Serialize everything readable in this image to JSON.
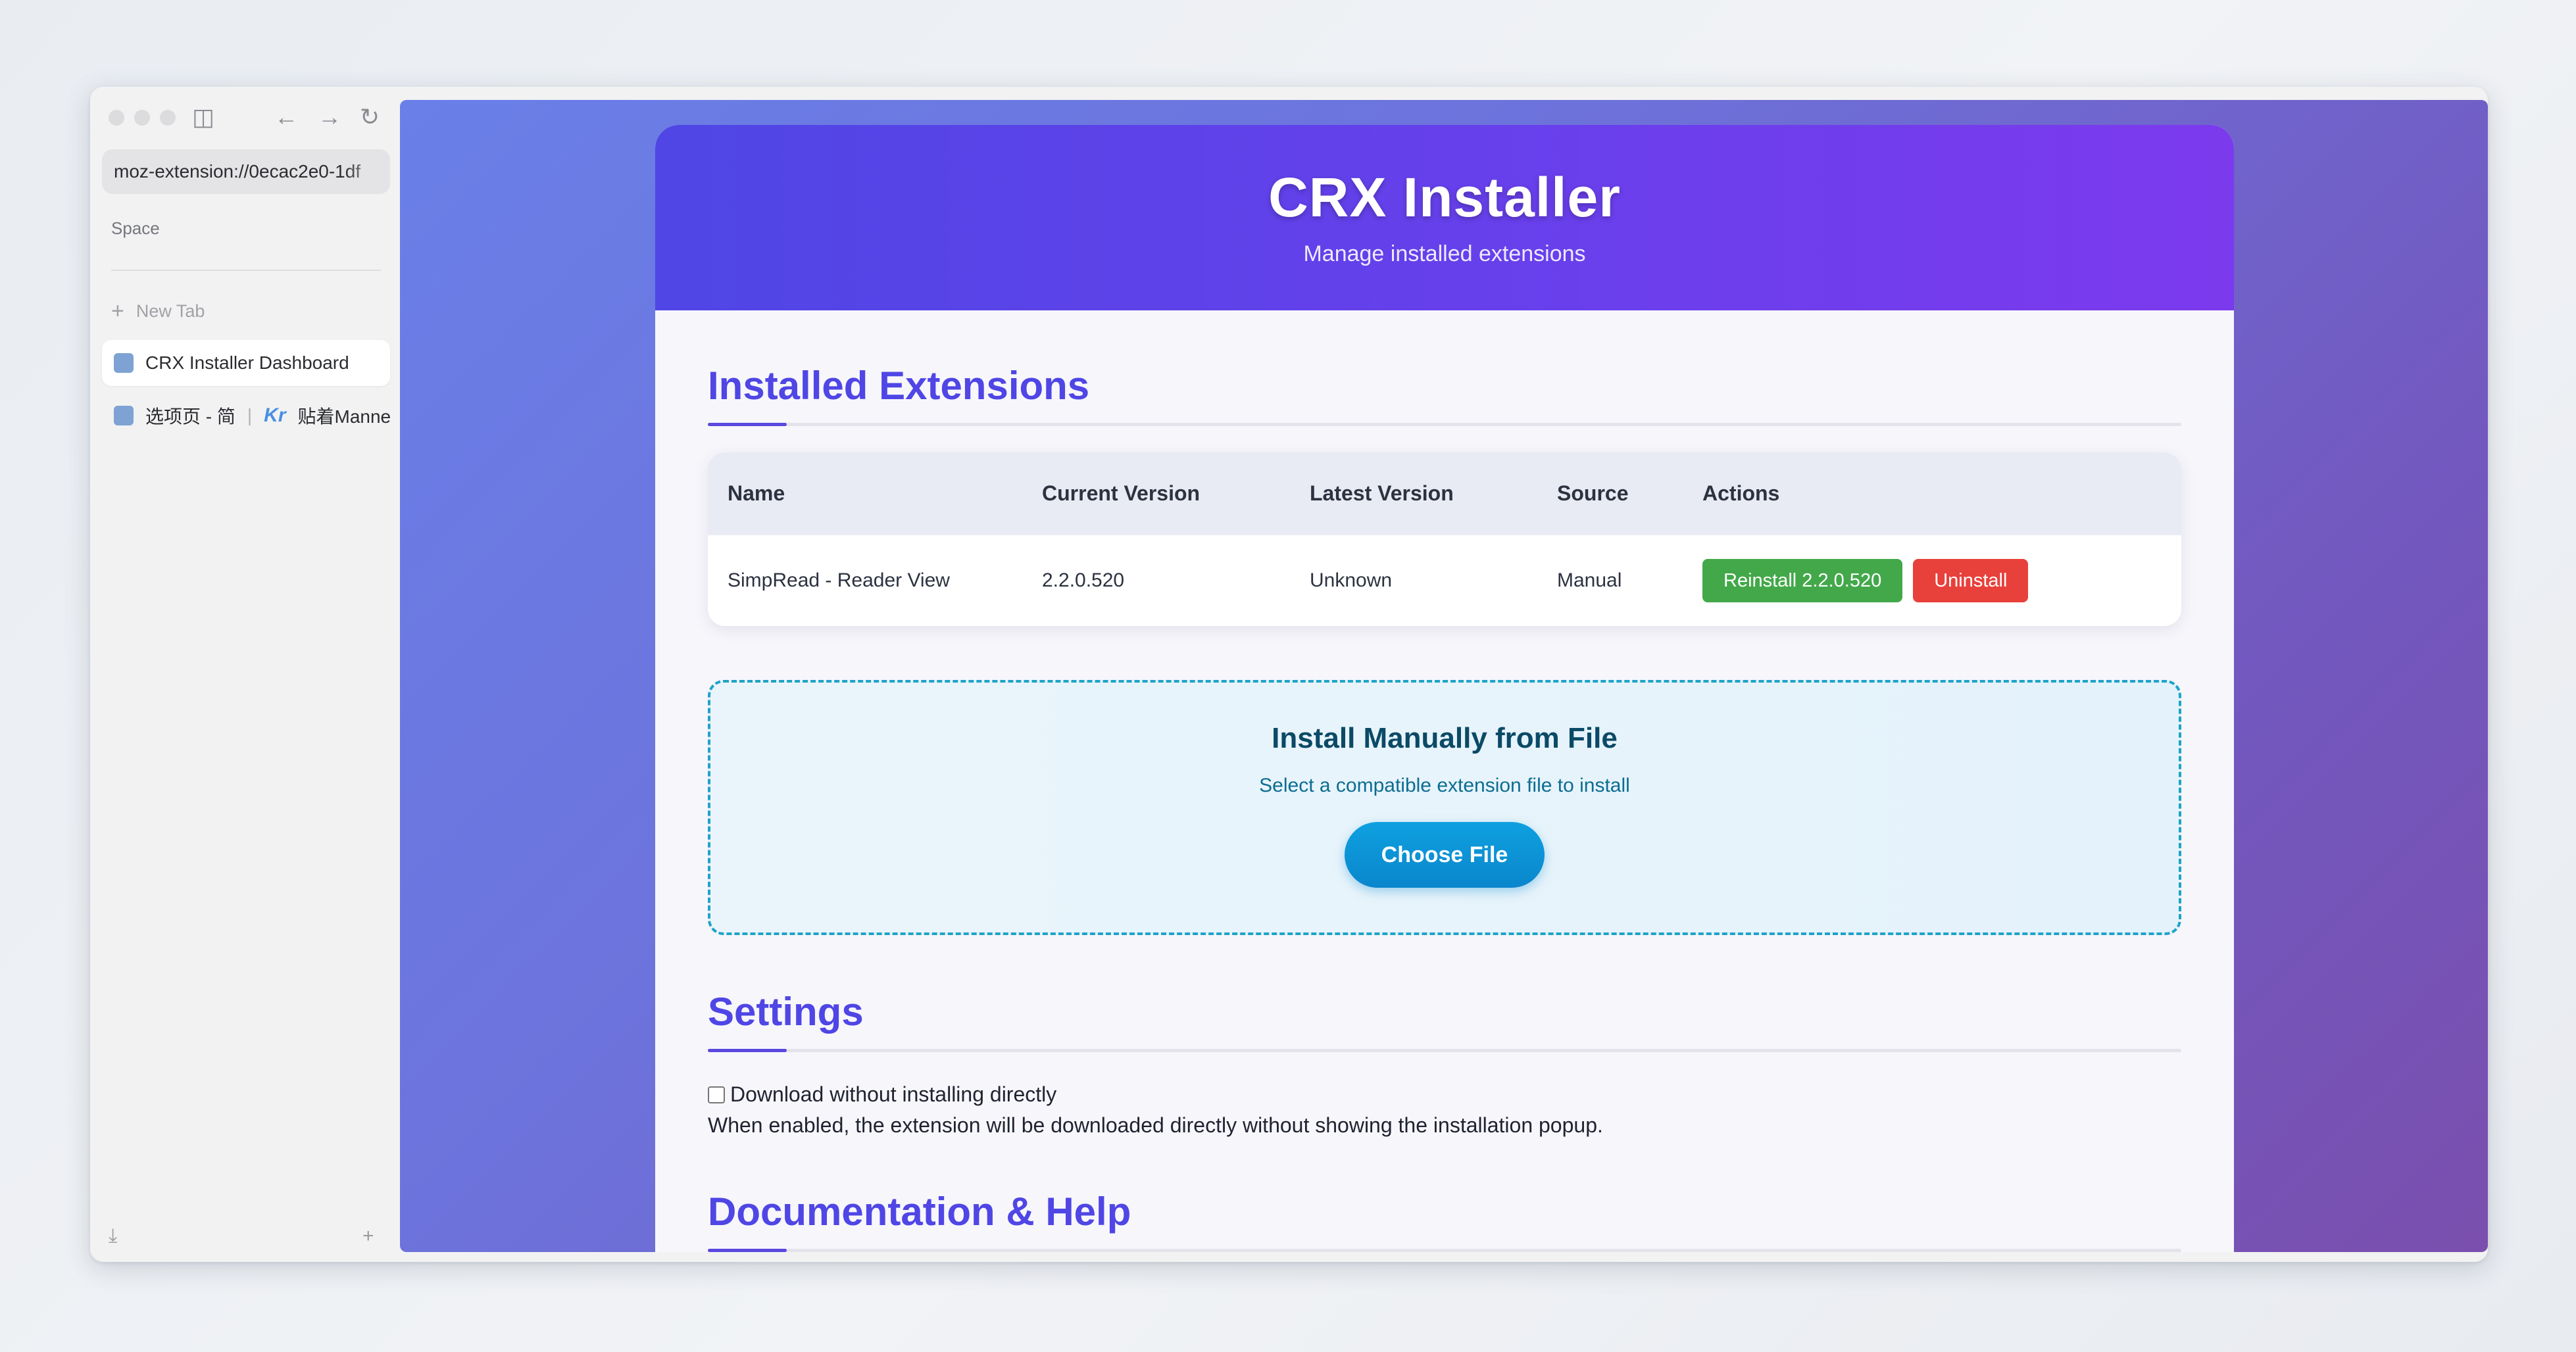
{
  "browser": {
    "url": "moz-extension://0ecac2e0-1df",
    "space_label": "Space",
    "new_tab_label": "New Tab",
    "tabs": [
      {
        "label": "CRX Installer Dashboard",
        "active": true
      },
      {
        "label_a": "选项页 - 简",
        "label_b": "贴着Manne",
        "active": false
      }
    ]
  },
  "hero": {
    "title": "CRX Installer",
    "subtitle": "Manage installed extensions"
  },
  "installed": {
    "title": "Installed Extensions",
    "columns": [
      "Name",
      "Current Version",
      "Latest Version",
      "Source",
      "Actions"
    ],
    "rows": [
      {
        "name": "SimpRead - Reader View",
        "current_version": "2.2.0.520",
        "latest_version": "Unknown",
        "source": "Manual",
        "reinstall_label": "Reinstall 2.2.0.520",
        "uninstall_label": "Uninstall"
      }
    ]
  },
  "manual_install": {
    "title": "Install Manually from File",
    "description": "Select a compatible extension file to install",
    "button_label": "Choose File"
  },
  "settings": {
    "title": "Settings",
    "option_label": "Download without installing directly",
    "option_checked": false,
    "option_description": "When enabled, the extension will be downloaded directly without showing the installation popup."
  },
  "docs": {
    "title": "Documentation & Help"
  },
  "colors": {
    "accent": "#4f46e5",
    "reinstall": "#43a84a",
    "uninstall": "#e8403a",
    "choose_file": "#0a86cc"
  }
}
